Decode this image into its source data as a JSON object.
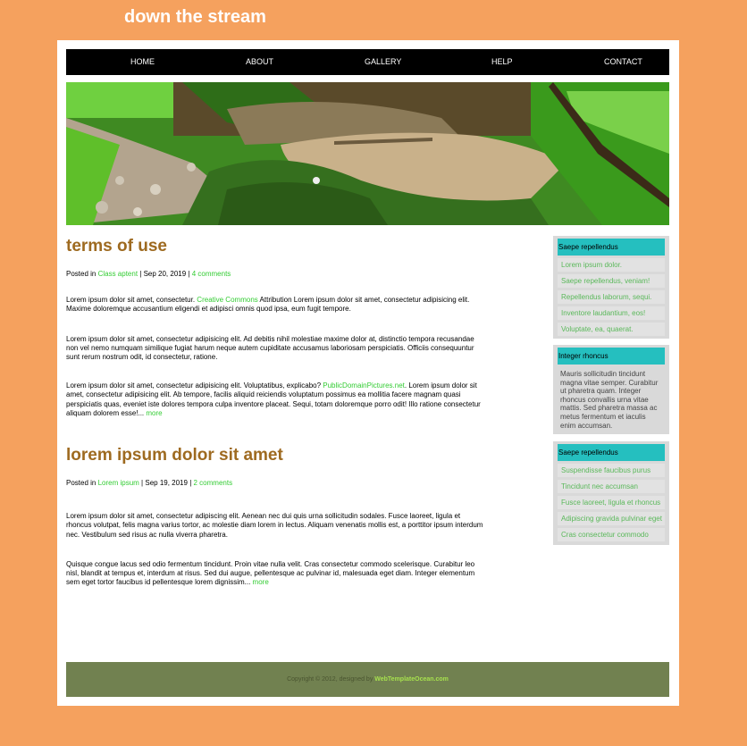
{
  "site": {
    "title": "down the stream"
  },
  "nav": [
    "HOME",
    "ABOUT",
    "GALLERY",
    "HELP",
    "CONTACT"
  ],
  "posts": [
    {
      "title": "terms of use",
      "posted_in_prefix": "Posted in ",
      "category": "Class aptent",
      "date": "Sep 20, 2019",
      "comments": "4 comments",
      "p1_text": "Lorem ipsum dolor sit amet, consectetur. ",
      "p1_link": "Creative Commons",
      "p1_rest": " Attribution Lorem ipsum dolor sit amet, consectetur adipisicing elit. Maxime doloremque accusantium eligendi et adipisci omnis quod ipsa, eum fugit tempore.",
      "p2": "Lorem ipsum dolor sit amet, consectetur adipisicing elit. Ad debitis nihil molestiae maxime dolor at, distinctio tempora recusandae non vel nemo numquam similique fugiat harum neque autem cupiditate accusamus laboriosam perspiciatis. Officiis consequuntur sunt rerum nostrum odit, id consectetur, ratione.",
      "p3_text": "Lorem ipsum dolor sit amet, consectetur adipisicing elit. Voluptatibus, explicabo? ",
      "p3_link": "PublicDomainPictures.net",
      "p3_rest": ". Lorem ipsum dolor sit amet, consectetur adipisicing elit. Ab tempore, facilis aliquid reiciendis voluptatum possimus ea mollitia facere magnam quasi perspiciatis quas, eveniet iste dolores tempora culpa inventore placeat. Sequi, totam doloremque porro odit! Illo ratione consectetur aliquam dolorem esse!... ",
      "more": "more"
    },
    {
      "title": "lorem ipsum dolor sit amet",
      "posted_in_prefix": "Posted in ",
      "category": "Lorem ipsum",
      "date": "Sep 19, 2019",
      "comments": "2 comments",
      "p1": "Lorem ipsum dolor sit amet, consectetur adipiscing elit. Aenean nec dui quis urna sollicitudin sodales. Fusce laoreet, ligula et rhoncus volutpat, felis magna varius tortor, ac molestie diam lorem in lectus. Aliquam venenatis mollis est, a porttitor ipsum interdum nec. Vestibulum sed risus ac nulla viverra pharetra.",
      "p2_text": "Quisque congue lacus sed odio fermentum tincidunt. Proin vitae nulla velit. Cras consectetur commodo scelerisque. Curabitur leo nisl, blandit at tempus et, interdum at risus. Sed dui augue, pellentesque ac pulvinar id, malesuada eget diam. Integer elementum sem eget tortor faucibus id pellentesque lorem dignissim... ",
      "more": "more"
    }
  ],
  "sidebar": [
    {
      "heading": "Saepe repellendus",
      "links": [
        "Lorem ipsum dolor.",
        "Saepe repellendus, veniam!",
        "Repellendus laborum, sequi.",
        "Inventore laudantium, eos!",
        "Voluptate, ea, quaerat."
      ]
    },
    {
      "heading": "Integer rhoncus",
      "text": "Mauris sollicitudin tincidunt magna vitae semper. Curabitur ut pharetra quam. Integer rhoncus convallis urna vitae mattis. Sed pharetra massa ac metus fermentum et iaculis enim accumsan."
    },
    {
      "heading": "Saepe repellendus",
      "links": [
        "Suspendisse faucibus purus",
        "Tincidunt nec accumsan",
        "Fusce laoreet, ligula et rhoncus",
        "Adipiscing gravida pulvinar eget",
        "Cras consectetur commodo"
      ]
    }
  ],
  "footer": {
    "text": "Copyright © 2012, designed by ",
    "link": "WebTemplateOcean.com"
  },
  "colors": {
    "background": "#f5a15e",
    "accent": "#25bfbf",
    "title": "#9e6a20",
    "link": "#33cc33",
    "footer": "#718150"
  }
}
